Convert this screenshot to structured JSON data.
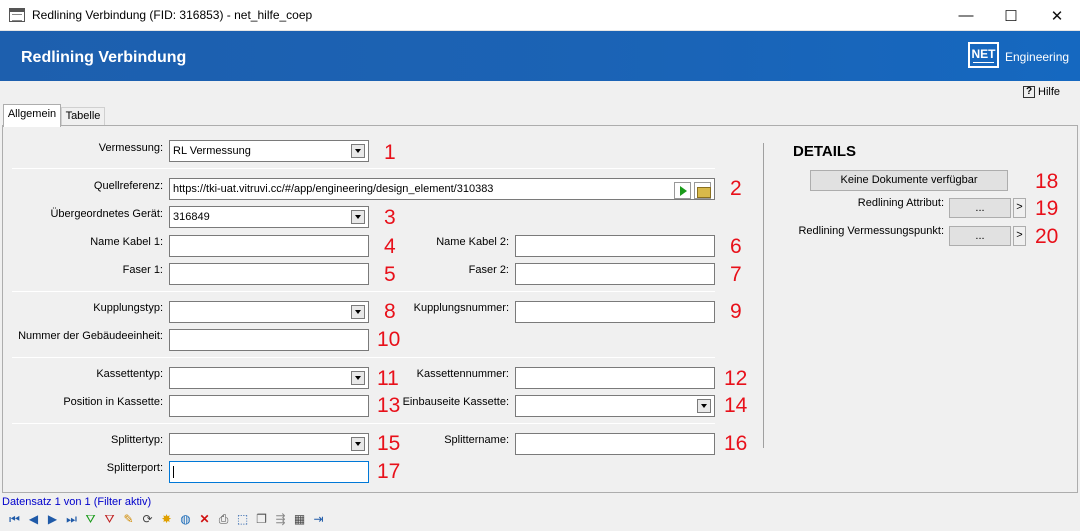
{
  "window": {
    "title": "Redlining Verbindung (FID: 316853) - net_hilfe_coep",
    "minimize": "—",
    "maximize": "☐",
    "close": "✕"
  },
  "banner": {
    "title": "Redlining Verbindung",
    "logo_text": "NET",
    "brand": "Engineering"
  },
  "help": {
    "label": "Hilfe"
  },
  "tabs": [
    {
      "label": "Allgemein",
      "active": true
    },
    {
      "label": "Tabelle",
      "active": false
    }
  ],
  "form": {
    "vermessung": {
      "label": "Vermessung:",
      "value": "RL Vermessung",
      "num": "1"
    },
    "quellreferenz": {
      "label": "Quellreferenz:",
      "value": "https://tki-uat.vitruvi.cc/#/app/engineering/design_element/310383",
      "num": "2"
    },
    "uebergeordnetes_geraet": {
      "label": "Übergeordnetes Gerät:",
      "value": "316849",
      "num": "3"
    },
    "name_kabel_1": {
      "label": "Name Kabel 1:",
      "value": "",
      "num": "4"
    },
    "faser_1": {
      "label": "Faser 1:",
      "value": "",
      "num": "5"
    },
    "name_kabel_2": {
      "label": "Name Kabel 2:",
      "value": "",
      "num": "6"
    },
    "faser_2": {
      "label": "Faser 2:",
      "value": "",
      "num": "7"
    },
    "kupplungstyp": {
      "label": "Kupplungstyp:",
      "value": "",
      "num": "8"
    },
    "kupplungsnummer": {
      "label": "Kupplungsnummer:",
      "value": "",
      "num": "9"
    },
    "nummer_gebaeudeeinheit": {
      "label": "Nummer der Gebäudeeinheit:",
      "value": "",
      "num": "10"
    },
    "kassettentyp": {
      "label": "Kassettentyp:",
      "value": "",
      "num": "11"
    },
    "kassettennummer": {
      "label": "Kassettennummer:",
      "value": "",
      "num": "12"
    },
    "position_in_kassette": {
      "label": "Position in Kassette:",
      "value": "",
      "num": "13"
    },
    "einbauseite_kassette": {
      "label": "Einbauseite Kassette:",
      "value": "",
      "num": "14"
    },
    "splittertyp": {
      "label": "Splittertyp:",
      "value": "",
      "num": "15"
    },
    "splittername": {
      "label": "Splittername:",
      "value": "",
      "num": "16"
    },
    "splitterport": {
      "label": "Splitterport:",
      "value": "",
      "num": "17"
    }
  },
  "details": {
    "heading": "DETAILS",
    "documents_button": "Keine Dokumente verfügbar",
    "documents_num": "18",
    "redlining_attribut": {
      "label": "Redlining Attribut:",
      "button": "...",
      "arrow": ">",
      "num": "19"
    },
    "redlining_vermessungspunkt": {
      "label": "Redlining Vermessungspunkt:",
      "button": "...",
      "arrow": ">",
      "num": "20"
    }
  },
  "status": {
    "text": "Datensatz 1 von 1 (Filter aktiv)"
  },
  "toolbar_icons": [
    "first-record-icon",
    "previous-record-icon",
    "next-record-icon",
    "last-record-icon",
    "add-filter-icon",
    "remove-filter-icon",
    "edit-pencil-icon",
    "refresh-icon",
    "new-record-icon",
    "globe-icon",
    "delete-icon",
    "print-icon",
    "select-area-icon",
    "copy-icon",
    "move-icon",
    "table-edit-icon",
    "exit-icon"
  ],
  "colors": {
    "banner_blue": "#1b63b5",
    "annotation_red": "#e8101a",
    "status_blue": "#0000cc"
  }
}
